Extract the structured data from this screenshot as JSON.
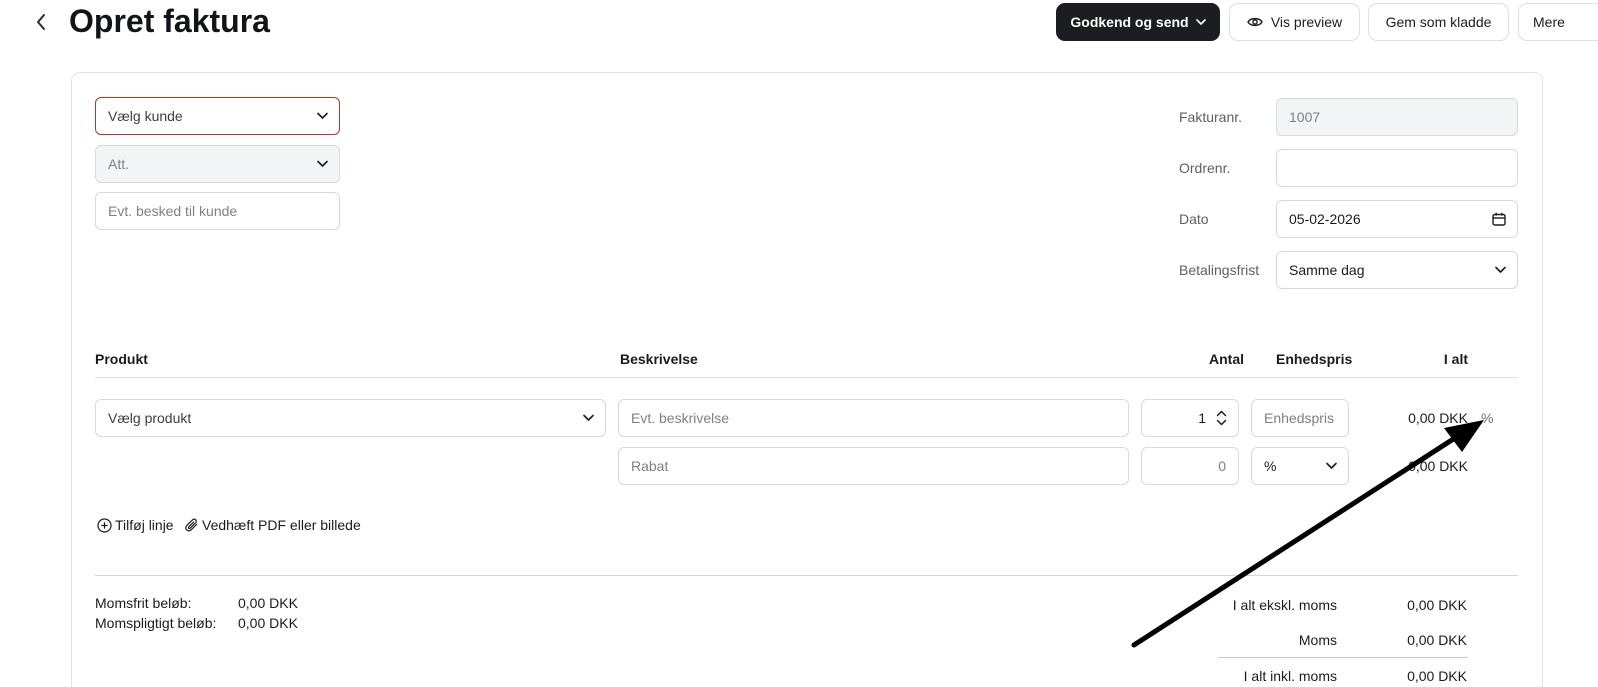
{
  "header": {
    "title": "Opret faktura",
    "approve_send_label": "Godkend og send",
    "preview_label": "Vis preview",
    "save_draft_label": "Gem som kladde",
    "more_label": "Mere"
  },
  "customer": {
    "customer_placeholder": "Vælg kunde",
    "att_placeholder": "Att.",
    "message_placeholder": "Evt. besked til kunde"
  },
  "invoice_meta": {
    "invoice_no_label": "Fakturanr.",
    "invoice_no_value": "1007",
    "order_no_label": "Ordrenr.",
    "order_no_value": "",
    "date_label": "Dato",
    "date_value": "05-02-2026",
    "payment_terms_label": "Betalingsfrist",
    "payment_terms_value": "Samme dag"
  },
  "lines_table": {
    "columns": [
      "Produkt",
      "Beskrivelse",
      "Antal",
      "Enhedspris",
      "I alt"
    ],
    "line": {
      "product_placeholder": "Vælg produkt",
      "description_placeholder": "Evt. beskrivelse",
      "quantity": "1",
      "unit_price_placeholder": "Enhedspris",
      "total": "0,00 DKK",
      "percent_toggle": "%"
    },
    "discount": {
      "description_placeholder": "Rabat",
      "amount_placeholder": "0",
      "unit": "%",
      "total": "0,00 DKK"
    }
  },
  "actions": {
    "add_line_label": "Tilføj linje",
    "attach_label": "Vedhæft PDF eller billede"
  },
  "vat_summary": {
    "exempt_label": "Momsfrit beløb:",
    "exempt_value": "0,00 DKK",
    "liable_label": "Momspligtigt beløb:",
    "liable_value": "0,00 DKK"
  },
  "totals": {
    "excl_vat_label": "I alt ekskl. moms",
    "excl_vat_value": "0,00 DKK",
    "vat_label": "Moms",
    "vat_value": "0,00 DKK",
    "incl_vat_label": "I alt inkl. moms",
    "incl_vat_value": "0,00 DKK"
  },
  "colors": {
    "primary_button": "#1c1d21",
    "error_border": "#b8372a",
    "annotation_arrow": "#000000"
  }
}
